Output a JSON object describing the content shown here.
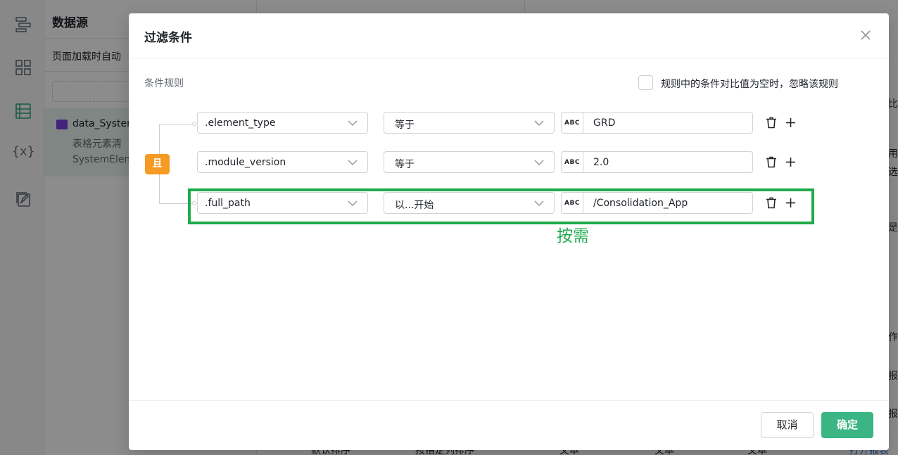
{
  "background": {
    "rail": {
      "icons": [
        "layers-icon",
        "grid-icon",
        "datasource-icon",
        "variable-icon",
        "copy-edit-icon"
      ],
      "variable_glyph": "{x}",
      "active_color": "#2aa876"
    },
    "datasource_panel": {
      "title": "数据源",
      "subtitle": "页面加载时自动",
      "item": {
        "name": "data_Systen",
        "description": "表格元素清",
        "type": "SystemElem"
      }
    },
    "bottom_texts": [
      "默认排序",
      "按指定列排序",
      "文本",
      "文本",
      "文本",
      "打开报表"
    ],
    "right_edge_texts": [
      "比",
      "用z",
      "选扌",
      "是(",
      "作",
      "报表",
      "报表"
    ]
  },
  "dialog": {
    "title": "过滤条件",
    "close_icon": "close-icon",
    "rules_label": "条件规则",
    "ignore_empty_label": "规则中的条件对比值为空时，忽略该规则",
    "ignore_empty_checked": false,
    "logic_badge": "且",
    "logic_color": "#f59a23",
    "value_type_badge": "ABC",
    "conditions": [
      {
        "field": ".element_type",
        "operator": "等于",
        "value": "GRD"
      },
      {
        "field": ".module_version",
        "operator": "等于",
        "value": "2.0"
      },
      {
        "field": ".full_path",
        "operator": "以...开始",
        "value": "/Consolidation_App"
      }
    ],
    "annotation": "按需",
    "annotation_color": "#1faa4c",
    "cancel_label": "取消",
    "confirm_label": "确定",
    "confirm_color": "#3cb584"
  }
}
